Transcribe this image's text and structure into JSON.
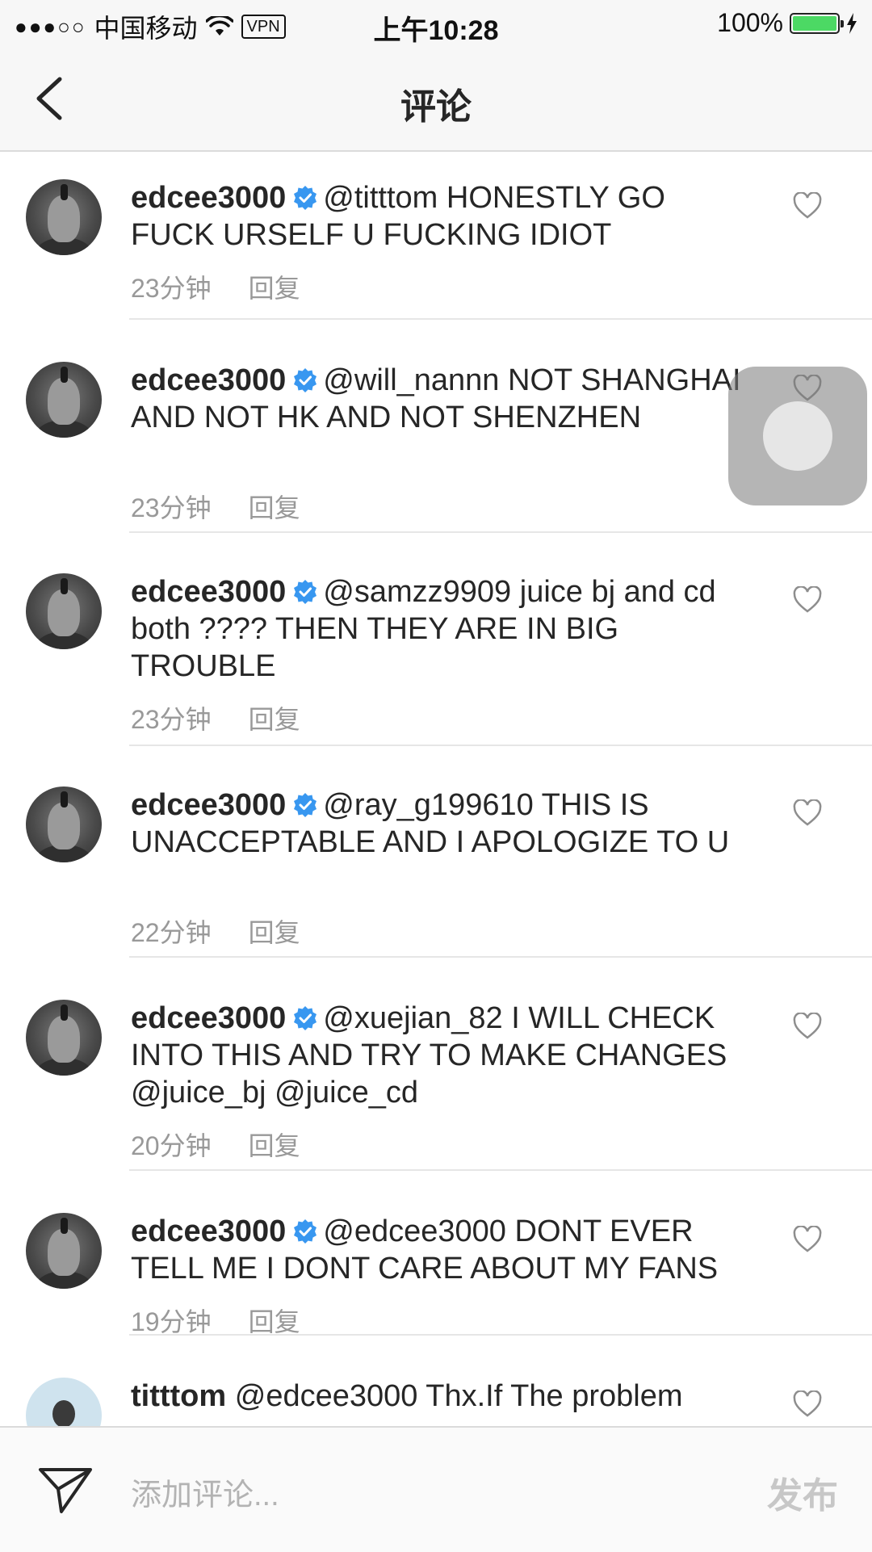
{
  "status_bar": {
    "carrier": "中国移动",
    "signal": "●●●○○",
    "vpn": "VPN",
    "time": "上午10:28",
    "battery": "100%",
    "battery_level": 1.0
  },
  "nav": {
    "title": "评论",
    "back_icon": "chevron-left-icon"
  },
  "comments": [
    {
      "user": "edcee3000",
      "verified": true,
      "text": "@titttom HONESTLY GO FUCK URSELF U FUCKING IDIOT",
      "time": "23分钟",
      "reply": "回复"
    },
    {
      "user": "edcee3000",
      "verified": true,
      "text": "@will_nannn NOT SHANGHAI AND NOT HK AND NOT SHENZHEN",
      "time": "23分钟",
      "reply": "回复"
    },
    {
      "user": "edcee3000",
      "verified": true,
      "text": "@samzz9909 juice bj and cd both ???? THEN THEY ARE IN BIG TROUBLE",
      "time": "23分钟",
      "reply": "回复"
    },
    {
      "user": "edcee3000",
      "verified": true,
      "text": "@ray_g199610 THIS IS UNACCEPTABLE AND I APOLOGIZE TO U",
      "time": "22分钟",
      "reply": "回复"
    },
    {
      "user": "edcee3000",
      "verified": true,
      "text": "@xuejian_82 I WILL CHECK INTO THIS AND TRY TO MAKE CHANGES @juice_bj @juice_cd",
      "time": "20分钟",
      "reply": "回复"
    },
    {
      "user": "edcee3000",
      "verified": true,
      "text": "@edcee3000 DONT EVER TELL ME I DONT CARE ABOUT MY FANS",
      "time": "19分钟",
      "reply": "回复"
    },
    {
      "user": "titttom",
      "verified": false,
      "text": "@edcee3000 Thx.If The problem",
      "time": "",
      "reply": ""
    }
  ],
  "composer": {
    "placeholder": "添加评论...",
    "post_label": "发布",
    "icon": "send-icon"
  },
  "colors": {
    "verified": "#3897f0",
    "meta_text": "#999999",
    "post_disabled": "#c7c7c7"
  }
}
